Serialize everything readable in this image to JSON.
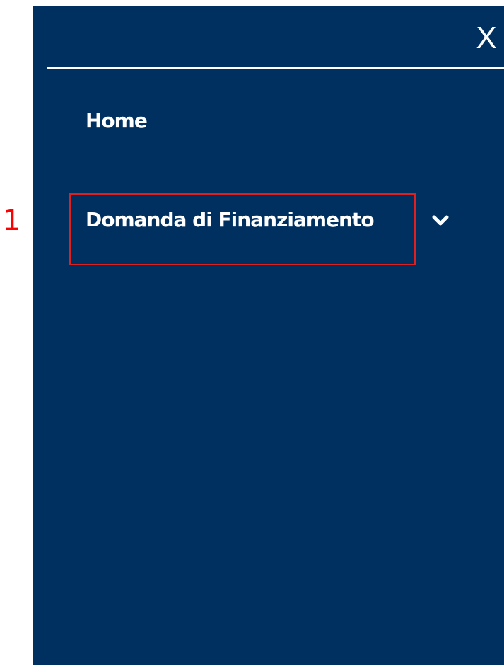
{
  "menu": {
    "close_label": "X",
    "items": [
      {
        "label": "Home"
      },
      {
        "label": "Domanda di Finanziamento",
        "has_submenu": true,
        "submenu_icon": "chevron-down-icon"
      }
    ]
  },
  "annotation": {
    "number": "1",
    "color": "#ff0000"
  },
  "colors": {
    "panel_background": "#003060",
    "text": "#ffffff"
  }
}
